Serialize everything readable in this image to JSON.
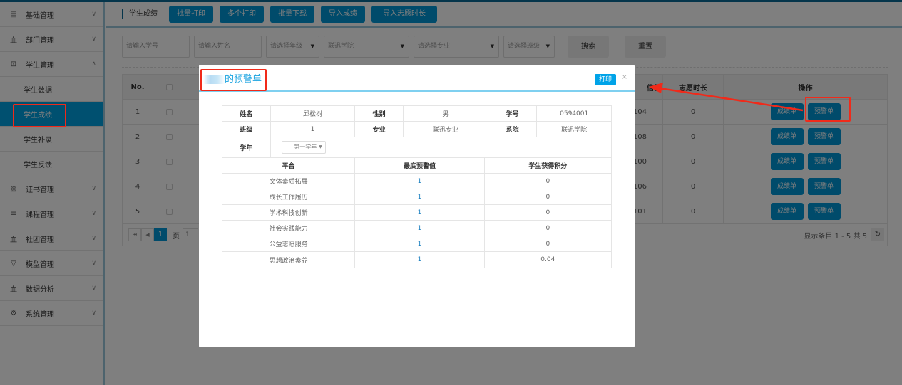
{
  "sidebar": {
    "items": [
      {
        "label": "基础管理",
        "icon": "document-icon",
        "expanded": false
      },
      {
        "label": "部门管理",
        "icon": "building-icon",
        "expanded": false
      },
      {
        "label": "学生管理",
        "icon": "student-icon",
        "expanded": true,
        "children": [
          "学生数据",
          "学生成绩",
          "学生补录",
          "学生反馈"
        ],
        "active_child": "学生成绩"
      },
      {
        "label": "证书管理",
        "icon": "certificate-icon",
        "expanded": false
      },
      {
        "label": "课程管理",
        "icon": "list-icon",
        "expanded": false
      },
      {
        "label": "社团管理",
        "icon": "building-icon",
        "expanded": false
      },
      {
        "label": "模型管理",
        "icon": "funnel-icon",
        "expanded": false
      },
      {
        "label": "数据分析",
        "icon": "building-icon",
        "expanded": false
      },
      {
        "label": "系统管理",
        "icon": "gear-icon",
        "expanded": false
      }
    ]
  },
  "header": {
    "title": "学生成绩",
    "buttons": [
      "批量打印",
      "多个打印",
      "批量下载",
      "导入成绩",
      "导入志愿时长"
    ]
  },
  "filters": {
    "student_id_placeholder": "请输入学号",
    "name_placeholder": "请输入姓名",
    "grade": "请选择年级",
    "college": "联迅学院",
    "major": "请选择专业",
    "class": "请选择班级",
    "search": "搜索",
    "reset": "重置"
  },
  "table": {
    "headers": {
      "no": "No.",
      "credit": "信值",
      "volunteer": "志愿时长",
      "actions": "操作"
    },
    "rows": [
      {
        "no": "1",
        "credit": "104",
        "volunteer": "0"
      },
      {
        "no": "2",
        "credit": "108",
        "volunteer": "0"
      },
      {
        "no": "3",
        "credit": "100",
        "volunteer": "0"
      },
      {
        "no": "4",
        "credit": "106",
        "volunteer": "0"
      },
      {
        "no": "5",
        "credit": "101",
        "volunteer": "0"
      }
    ],
    "action_grades": "成绩单",
    "action_warning": "预警单"
  },
  "pager": {
    "current": "1",
    "page_label": "页",
    "page_input": "1",
    "summary": "显示条目 1 - 5 共 5"
  },
  "modal": {
    "title_suffix": "的预警单",
    "print": "打印",
    "close": "×",
    "info": {
      "name_label": "姓名",
      "name": "邱松树",
      "gender_label": "性别",
      "gender": "男",
      "id_label": "学号",
      "id": "0594001",
      "class_label": "班级",
      "class": "1",
      "major_label": "专业",
      "major": "联迅专业",
      "college_label": "系院",
      "college": "联迅学院",
      "year_label": "学年",
      "year": "第一学年"
    },
    "headers": [
      "平台",
      "最底预警值",
      "学生获得积分"
    ],
    "rows": [
      {
        "platform": "文体素质拓展",
        "threshold": "1",
        "score": "0"
      },
      {
        "platform": "成长工作履历",
        "threshold": "1",
        "score": "0"
      },
      {
        "platform": "学术科技创新",
        "threshold": "1",
        "score": "0"
      },
      {
        "platform": "社会实践能力",
        "threshold": "1",
        "score": "0"
      },
      {
        "platform": "公益志愿服务",
        "threshold": "1",
        "score": "0"
      },
      {
        "platform": "思想政治素养",
        "threshold": "1",
        "score": "0.04"
      }
    ]
  }
}
